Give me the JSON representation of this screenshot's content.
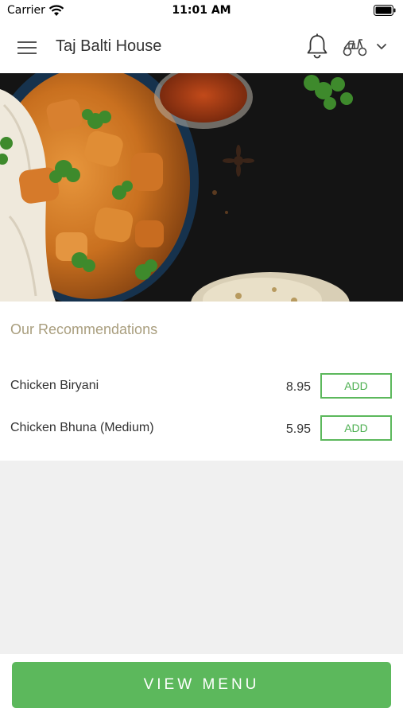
{
  "status_bar": {
    "carrier": "Carrier",
    "time": "11:01 AM"
  },
  "header": {
    "title": "Taj Balti House",
    "icons": [
      "menu-icon",
      "bell-icon",
      "scooter-icon",
      "chevron-down-icon"
    ]
  },
  "recommendations": {
    "title": "Our Recommendations",
    "items": [
      {
        "name": "Chicken Biryani",
        "price": "8.95",
        "button": "ADD"
      },
      {
        "name": "Chicken Bhuna (Medium)",
        "price": "5.95",
        "button": "ADD"
      }
    ]
  },
  "footer": {
    "view_menu_label": "VIEW MENU"
  },
  "colors": {
    "accent_green": "#5cb85c",
    "section_title": "#a99e7e",
    "background": "#f0f0f0"
  }
}
